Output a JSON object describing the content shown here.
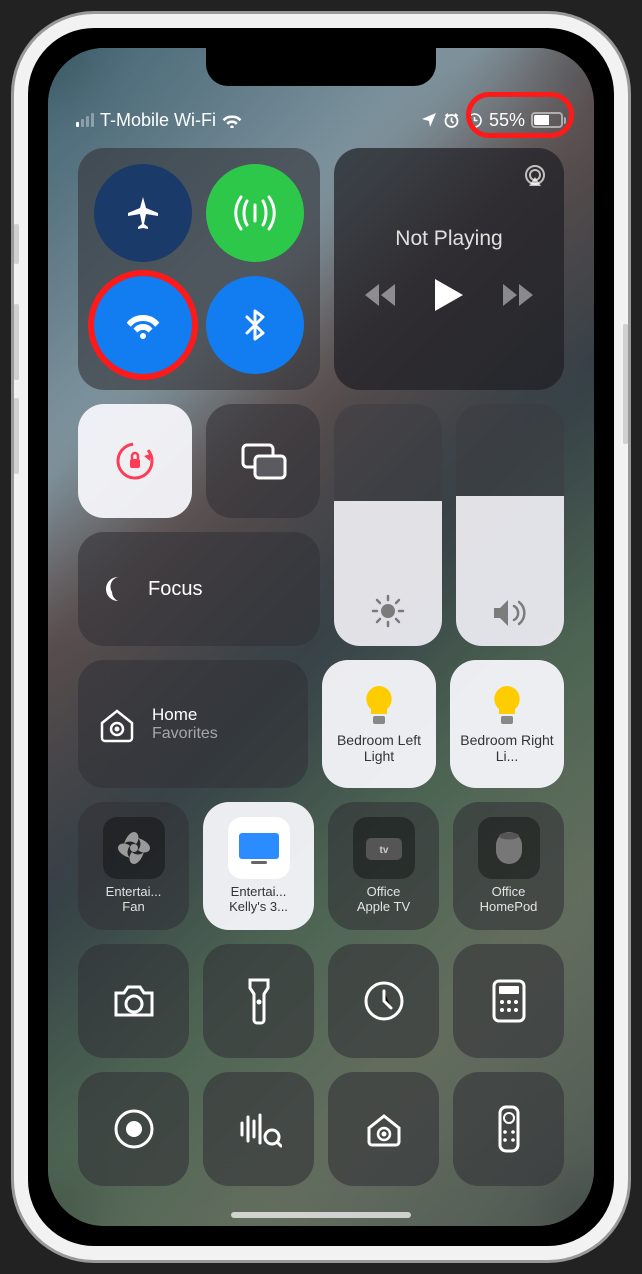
{
  "status": {
    "carrier": "T-Mobile Wi-Fi",
    "battery_percent": "55%",
    "signal_bars_active": 1
  },
  "connectivity": {
    "airplane": {
      "on": false
    },
    "cellular": {
      "on": true
    },
    "wifi": {
      "on": true,
      "highlighted": true
    },
    "bluetooth": {
      "on": true
    }
  },
  "media": {
    "status": "Not Playing"
  },
  "lock": {
    "orientation_locked": true
  },
  "focus": {
    "label": "Focus"
  },
  "brightness": {
    "level": 0.6
  },
  "volume": {
    "level": 0.62
  },
  "home": {
    "title": "Home",
    "subtitle": "Favorites"
  },
  "lights": [
    {
      "label": "Bedroom Left Light"
    },
    {
      "label": "Bedroom Right Li..."
    }
  ],
  "accessories": [
    {
      "label1": "Entertai...",
      "label2": "Fan",
      "white": false,
      "type": "fan"
    },
    {
      "label1": "Entertai...",
      "label2": "Kelly's 3...",
      "white": true,
      "type": "tv"
    },
    {
      "label1": "Office",
      "label2": "Apple TV",
      "white": false,
      "type": "appletv"
    },
    {
      "label1": "Office",
      "label2": "HomePod",
      "white": false,
      "type": "homepod"
    }
  ],
  "shortcuts_row1": [
    "camera",
    "flashlight",
    "timer",
    "calculator"
  ],
  "shortcuts_row2": [
    "screen-record",
    "shazam",
    "home",
    "remote"
  ]
}
